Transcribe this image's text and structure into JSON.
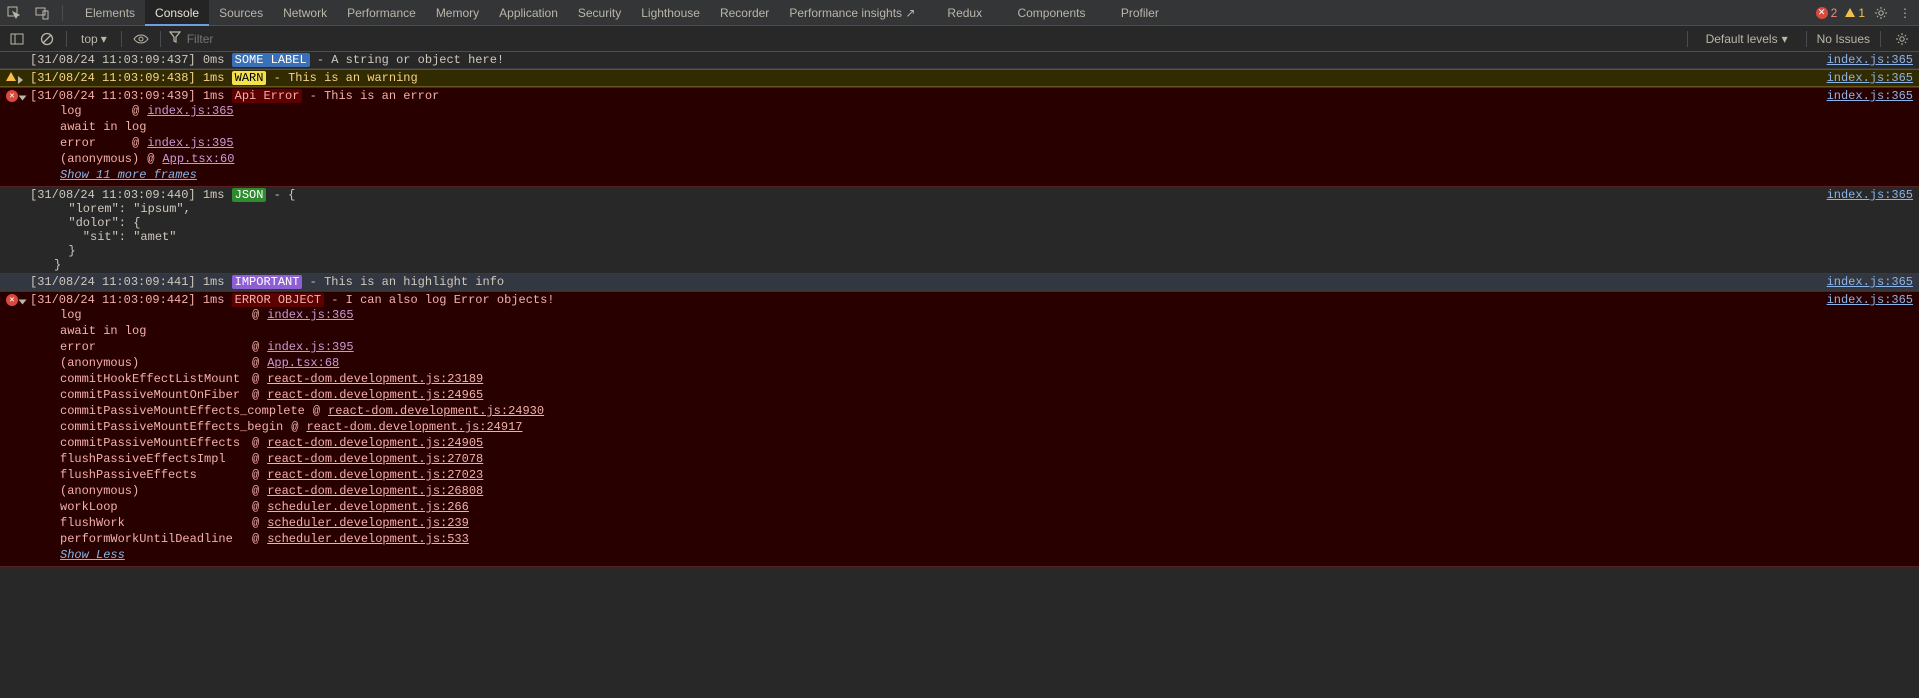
{
  "tabstrip": {
    "tabs": [
      "Elements",
      "Console",
      "Sources",
      "Network",
      "Performance",
      "Memory",
      "Application",
      "Security",
      "Lighthouse",
      "Recorder",
      "Performance insights"
    ],
    "redux": "Redux",
    "components": "Components",
    "profiler": "Profiler",
    "err_count": "2",
    "warn_count": "1"
  },
  "filterbar": {
    "context": "top",
    "filter_placeholder": "Filter",
    "levels": "Default levels",
    "issues": "No Issues"
  },
  "logs": [
    {
      "id": "l1",
      "timestamp": "[31/08/24 11:03:09:437]",
      "dur": "0ms",
      "badge_kind": "some",
      "badge": "SOME LABEL",
      "text": "A string or object here!",
      "src": "index.js:365"
    },
    {
      "id": "l2",
      "level": "warn",
      "expandable": true,
      "timestamp": "[31/08/24 11:03:09:438]",
      "dur": "1ms",
      "badge_kind": "warn",
      "badge": "WARN",
      "text": "This is an warning",
      "src": "index.js:365"
    },
    {
      "id": "l3",
      "level": "err",
      "expandable": true,
      "open": true,
      "timestamp": "[31/08/24 11:03:09:439]",
      "dur": "1ms",
      "badge_kind": "apierr",
      "badge": "Api Error",
      "text": "This is an error",
      "src": "index.js:365",
      "stack": [
        {
          "fn": "log",
          "link": "index.js:365",
          "cls": "stk-link"
        },
        {
          "fn": "await in log"
        },
        {
          "fn": "error",
          "link": "index.js:395",
          "cls": "stk-link"
        },
        {
          "fn": "(anonymous)",
          "link": "App.tsx:60",
          "cls": "stk-link"
        }
      ],
      "show_frames": "Show 11 more frames"
    },
    {
      "id": "l4",
      "timestamp": "[31/08/24 11:03:09:440]",
      "dur": "1ms",
      "badge_kind": "json",
      "badge": "JSON",
      "text": "{",
      "src": "index.js:365",
      "json_body": "  \"lorem\": \"ipsum\",\n  \"dolor\": {\n    \"sit\": \"amet\"\n  }\n}"
    },
    {
      "id": "l5",
      "level": "high",
      "timestamp": "[31/08/24 11:03:09:441]",
      "dur": "1ms",
      "badge_kind": "imp",
      "badge": "IMPORTANT",
      "text": "This is an highlight info",
      "src": "index.js:365"
    },
    {
      "id": "l6",
      "level": "err",
      "expandable": true,
      "open": true,
      "timestamp": "[31/08/24 11:03:09:442]",
      "dur": "1ms",
      "badge_kind": "errobj",
      "badge": "ERROR OBJECT",
      "text": "I can also log Error objects!",
      "src": "index.js:365",
      "fn_width": 184,
      "stack": [
        {
          "fn": "log",
          "link": "index.js:365",
          "cls": "stk-link"
        },
        {
          "fn": "await in log"
        },
        {
          "fn": "error",
          "link": "index.js:395",
          "cls": "stk-link"
        },
        {
          "fn": "(anonymous)",
          "link": "App.tsx:68",
          "cls": "stk-link"
        },
        {
          "fn": "commitHookEffectListMount",
          "link": "react-dom.development.js:23189",
          "cls": "stk-link2"
        },
        {
          "fn": "commitPassiveMountOnFiber",
          "link": "react-dom.development.js:24965",
          "cls": "stk-link2"
        },
        {
          "fn": "commitPassiveMountEffects_complete",
          "link": "react-dom.development.js:24930",
          "cls": "stk-link2"
        },
        {
          "fn": "commitPassiveMountEffects_begin",
          "link": "react-dom.development.js:24917",
          "cls": "stk-link2"
        },
        {
          "fn": "commitPassiveMountEffects",
          "link": "react-dom.development.js:24905",
          "cls": "stk-link2"
        },
        {
          "fn": "flushPassiveEffectsImpl",
          "link": "react-dom.development.js:27078",
          "cls": "stk-link2"
        },
        {
          "fn": "flushPassiveEffects",
          "link": "react-dom.development.js:27023",
          "cls": "stk-link2"
        },
        {
          "fn": "(anonymous)",
          "link": "react-dom.development.js:26808",
          "cls": "stk-link2"
        },
        {
          "fn": "workLoop",
          "link": "scheduler.development.js:266",
          "cls": "stk-link2"
        },
        {
          "fn": "flushWork",
          "link": "scheduler.development.js:239",
          "cls": "stk-link2"
        },
        {
          "fn": "performWorkUntilDeadline",
          "link": "scheduler.development.js:533",
          "cls": "stk-link2"
        }
      ],
      "show_frames": "Show Less"
    }
  ]
}
